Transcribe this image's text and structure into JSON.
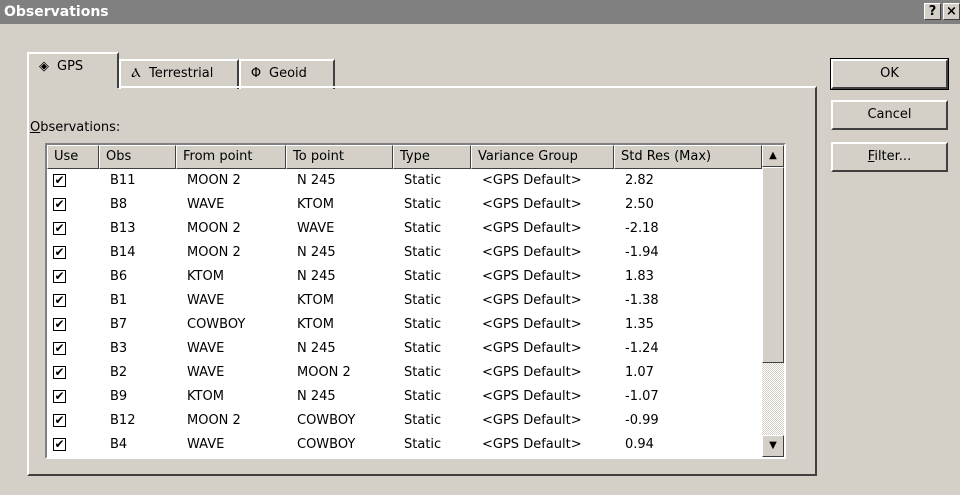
{
  "window": {
    "title": "Observations",
    "help_label": "?",
    "close_label": "×"
  },
  "tabs": [
    {
      "label": "GPS",
      "icon": "gps-satellite-icon",
      "active": true
    },
    {
      "label": "Terrestrial",
      "icon": "tripod-icon",
      "active": false
    },
    {
      "label": "Geoid",
      "icon": "geoid-icon",
      "active": false
    }
  ],
  "observations_label_underlined": "O",
  "observations_label_rest": "bservations:",
  "list": {
    "columns": [
      "Use",
      "Obs",
      "From point",
      "To point",
      "Type",
      "Variance Group",
      "Std Res (Max)"
    ],
    "rows": [
      {
        "use": "✔",
        "obs": "B11",
        "from": "MOON 2",
        "to": "N 245",
        "type": "Static",
        "group": "<GPS Default>",
        "res": "2.82"
      },
      {
        "use": "✔",
        "obs": "B8",
        "from": "WAVE",
        "to": "KTOM",
        "type": "Static",
        "group": "<GPS Default>",
        "res": "2.50"
      },
      {
        "use": "✔",
        "obs": "B13",
        "from": "MOON 2",
        "to": "WAVE",
        "type": "Static",
        "group": "<GPS Default>",
        "res": "-2.18"
      },
      {
        "use": "✔",
        "obs": "B14",
        "from": "MOON 2",
        "to": "N 245",
        "type": "Static",
        "group": "<GPS Default>",
        "res": "-1.94"
      },
      {
        "use": "✔",
        "obs": "B6",
        "from": "KTOM",
        "to": "N 245",
        "type": "Static",
        "group": "<GPS Default>",
        "res": "1.83"
      },
      {
        "use": "✔",
        "obs": "B1",
        "from": "WAVE",
        "to": "KTOM",
        "type": "Static",
        "group": "<GPS Default>",
        "res": "-1.38"
      },
      {
        "use": "✔",
        "obs": "B7",
        "from": "COWBOY",
        "to": "KTOM",
        "type": "Static",
        "group": "<GPS Default>",
        "res": "1.35"
      },
      {
        "use": "✔",
        "obs": "B3",
        "from": "WAVE",
        "to": "N 245",
        "type": "Static",
        "group": "<GPS Default>",
        "res": "-1.24"
      },
      {
        "use": "✔",
        "obs": "B2",
        "from": "WAVE",
        "to": "MOON 2",
        "type": "Static",
        "group": "<GPS Default>",
        "res": "1.07"
      },
      {
        "use": "✔",
        "obs": "B9",
        "from": "KTOM",
        "to": "N 245",
        "type": "Static",
        "group": "<GPS Default>",
        "res": "-1.07"
      },
      {
        "use": "✔",
        "obs": "B12",
        "from": "MOON 2",
        "to": "COWBOY",
        "type": "Static",
        "group": "<GPS Default>",
        "res": "-0.99"
      },
      {
        "use": "✔",
        "obs": "B4",
        "from": "WAVE",
        "to": "COWBOY",
        "type": "Static",
        "group": "<GPS Default>",
        "res": "0.94"
      }
    ]
  },
  "buttons": {
    "ok": "OK",
    "cancel": "Cancel",
    "filter_underlined": "F",
    "filter_rest": "ilter..."
  }
}
